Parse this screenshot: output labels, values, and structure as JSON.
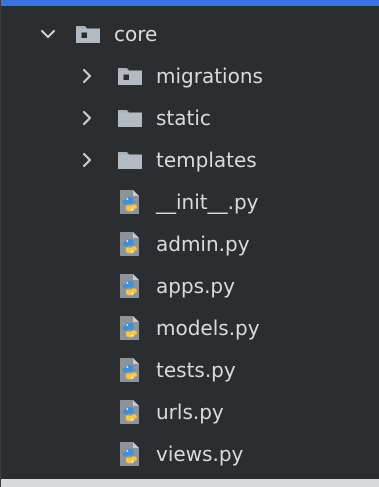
{
  "tree": {
    "root": {
      "label": "core",
      "icon": "package-folder-icon",
      "expanded": true
    },
    "folders": [
      {
        "label": "migrations",
        "icon": "package-folder-icon",
        "expanded": false
      },
      {
        "label": "static",
        "icon": "folder-icon",
        "expanded": false
      },
      {
        "label": "templates",
        "icon": "folder-icon",
        "expanded": false
      }
    ],
    "files": [
      {
        "label": "__init__.py",
        "icon": "python-file-icon"
      },
      {
        "label": "admin.py",
        "icon": "python-file-icon"
      },
      {
        "label": "apps.py",
        "icon": "python-file-icon"
      },
      {
        "label": "models.py",
        "icon": "python-file-icon"
      },
      {
        "label": "tests.py",
        "icon": "python-file-icon"
      },
      {
        "label": "urls.py",
        "icon": "python-file-icon"
      },
      {
        "label": "views.py",
        "icon": "python-file-icon"
      }
    ]
  },
  "colors": {
    "background": "#2b2d30",
    "text": "#d7dade",
    "folder": "#a9b0b7",
    "chevron": "#c9ccd0",
    "python_blue": "#3f8fd6",
    "python_yellow": "#f2c94c"
  }
}
